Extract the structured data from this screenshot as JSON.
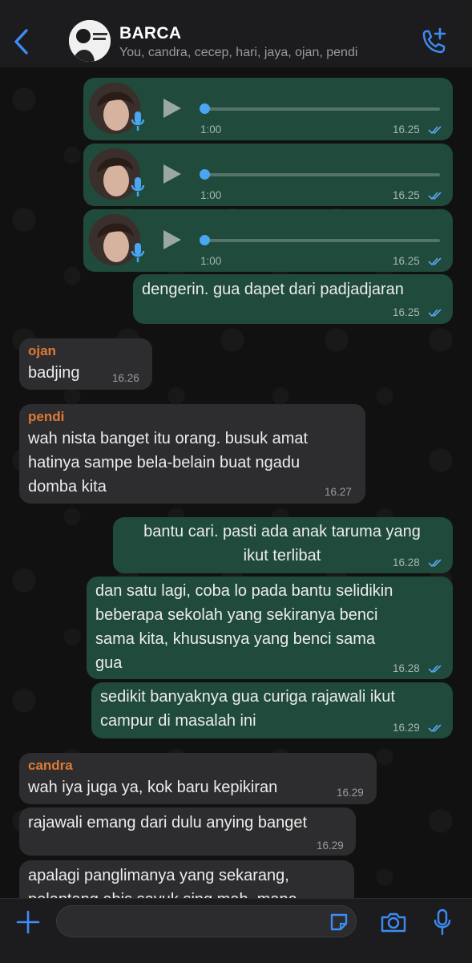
{
  "header": {
    "title": "BARCA",
    "subtitle": "You, candra, cecep, hari, jaya, ojan, pendi"
  },
  "messages": [
    {
      "type": "voice",
      "duration": "1:00",
      "time": "16.25",
      "read": true
    },
    {
      "type": "voice",
      "duration": "1:00",
      "time": "16.25",
      "read": true
    },
    {
      "type": "voice",
      "duration": "1:00",
      "time": "16.25",
      "read": true
    },
    {
      "type": "out",
      "text": "dengerin. gua dapet dari padjadjaran",
      "time": "16.25",
      "read": true
    },
    {
      "type": "in",
      "sender": "ojan",
      "text": "badjing",
      "time": "16.26"
    },
    {
      "type": "in",
      "sender": "pendi",
      "text": "wah nista banget itu orang. busuk amat\nhatinya sampe bela-belain buat ngadu\ndomba kita",
      "time": "16.27"
    },
    {
      "type": "out",
      "text": "bantu cari. pasti ada anak taruma yang\nikut terlibat",
      "time": "16.28",
      "read": true
    },
    {
      "type": "out",
      "text": "dan satu lagi, coba lo pada bantu selidikin\nbeberapa sekolah yang sekiranya benci\nsama kita, khususnya yang benci sama\ngua",
      "time": "16.28",
      "read": true
    },
    {
      "type": "out",
      "text": "sedikit banyaknya gua curiga rajawali ikut\ncampur di masalah ini",
      "time": "16.29",
      "read": true
    },
    {
      "type": "in",
      "sender": "candra",
      "text": "wah iya juga ya, kok baru kepikiran",
      "time": "16.29"
    },
    {
      "type": "in",
      "text": "rajawali emang dari dulu anying banget",
      "time": "16.29"
    },
    {
      "type": "in",
      "text": "apalagi panglimanya yang sekarang,\npelantang abis sayuk sing mah, mana",
      "time": ""
    }
  ],
  "composer": {
    "value": "",
    "placeholder": ""
  },
  "colors": {
    "outgoing": "#1f4a3c",
    "incoming": "#2d2d2f",
    "accent": "#3d8cf5",
    "sender": "#e07a35",
    "read_ticks": "#5aa7ef"
  },
  "icons": {
    "back": "chevron-left-icon",
    "call": "add-call-icon",
    "plus": "plus-icon",
    "sticker": "sticker-icon",
    "camera": "camera-icon",
    "mic": "microphone-icon",
    "play": "play-icon"
  }
}
